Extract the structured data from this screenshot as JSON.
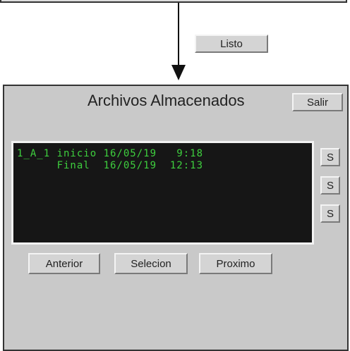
{
  "top": {
    "listo_label": "Listo"
  },
  "window": {
    "title": "Archivos Almacenados",
    "salir_label": "Salir",
    "record": {
      "line1": "1_A_1 inicio 16/05/19   9:18",
      "line2": "      Final  16/05/19  12:13"
    },
    "side_buttons": [
      "S",
      "S",
      "S"
    ],
    "nav": {
      "anterior": "Anterior",
      "selecion": "Selecion",
      "proximo": "Proximo"
    }
  }
}
